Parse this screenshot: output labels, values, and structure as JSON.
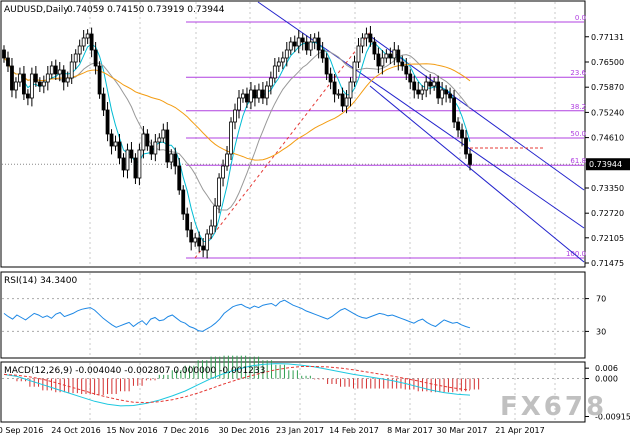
{
  "header": {
    "symbol": "AUDUSD,Daily",
    "ohlc": "0.74059 0.74150 0.73919 0.73944"
  },
  "watermark": "FX678",
  "chart_data": [
    {
      "type": "candlestick",
      "title": "AUDUSD,Daily",
      "ylim": [
        0.714,
        0.78
      ],
      "y_ticks": [
        "0.77131",
        "0.76500",
        "0.75870",
        "0.75240",
        "0.74610",
        "0.73944",
        "0.73350",
        "0.72720",
        "0.72105",
        "0.71475"
      ],
      "last_price": "0.73944",
      "x_ticks": [
        "30 Sep 2016",
        "24 Oct 2016",
        "15 Nov 2016",
        "7 Dec 2016",
        "30 Dec 2016",
        "23 Jan 2017",
        "14 Feb 2017",
        "8 Mar 2017",
        "30 Mar 2017",
        "21 Apr 2017"
      ],
      "closes": [
        0.766,
        0.764,
        0.758,
        0.76,
        0.762,
        0.757,
        0.756,
        0.762,
        0.76,
        0.759,
        0.76,
        0.762,
        0.764,
        0.762,
        0.763,
        0.76,
        0.761,
        0.765,
        0.767,
        0.769,
        0.771,
        0.772,
        0.768,
        0.764,
        0.757,
        0.753,
        0.747,
        0.744,
        0.745,
        0.741,
        0.738,
        0.743,
        0.741,
        0.736,
        0.743,
        0.747,
        0.744,
        0.742,
        0.745,
        0.746,
        0.748,
        0.74,
        0.742,
        0.739,
        0.733,
        0.727,
        0.723,
        0.72,
        0.721,
        0.719,
        0.718,
        0.722,
        0.724,
        0.729,
        0.736,
        0.739,
        0.742,
        0.75,
        0.753,
        0.756,
        0.757,
        0.755,
        0.758,
        0.756,
        0.758,
        0.756,
        0.759,
        0.761,
        0.764,
        0.765,
        0.766,
        0.768,
        0.77,
        0.769,
        0.771,
        0.77,
        0.768,
        0.77,
        0.771,
        0.768,
        0.766,
        0.762,
        0.76,
        0.757,
        0.757,
        0.754,
        0.756,
        0.76,
        0.765,
        0.769,
        0.771,
        0.772,
        0.77,
        0.767,
        0.764,
        0.766,
        0.767,
        0.766,
        0.768,
        0.765,
        0.764,
        0.762,
        0.76,
        0.758,
        0.757,
        0.758,
        0.76,
        0.759,
        0.76,
        0.756,
        0.758,
        0.757,
        0.756,
        0.75,
        0.748,
        0.746,
        0.742,
        0.7394
      ],
      "fib_levels": [
        {
          "label": "0.0",
          "value": 0.775
        },
        {
          "label": "23.6",
          "value": 0.7612
        },
        {
          "label": "38.2",
          "value": 0.7528
        },
        {
          "label": "50.0",
          "value": 0.746
        },
        {
          "label": "61.8",
          "value": 0.7392
        },
        {
          "label": "100.0",
          "value": 0.716
        }
      ],
      "moving_averages": [
        {
          "name": "fast",
          "color": "#00bcd4"
        },
        {
          "name": "medium",
          "color": "#999999"
        },
        {
          "name": "slow",
          "color": "#f39c12"
        }
      ]
    },
    {
      "type": "line",
      "title": "RSI(14) 34.3400",
      "ylim": [
        0,
        100
      ],
      "y_ticks": [
        "70",
        "30"
      ],
      "levels": [
        70,
        30
      ],
      "series": [
        {
          "name": "RSI(14)",
          "values": [
            52,
            48,
            45,
            50,
            47,
            44,
            48,
            52,
            50,
            47,
            49,
            46,
            51,
            53,
            48,
            50,
            52,
            55,
            57,
            58,
            59,
            56,
            51,
            46,
            42,
            38,
            35,
            37,
            39,
            41,
            36,
            40,
            43,
            38,
            45,
            47,
            43,
            44,
            48,
            50,
            46,
            42,
            40,
            36,
            34,
            31,
            30,
            33,
            36,
            40,
            45,
            52,
            56,
            60,
            62,
            63,
            60,
            58,
            61,
            59,
            62,
            63,
            64,
            61,
            66,
            68,
            65,
            62,
            60,
            58,
            55,
            53,
            51,
            49,
            47,
            45,
            48,
            52,
            56,
            58,
            55,
            52,
            49,
            47,
            46,
            48,
            50,
            52,
            51,
            49,
            50,
            48,
            46,
            44,
            42,
            40,
            43,
            45,
            41,
            38,
            36,
            40,
            44,
            42,
            40,
            41,
            38,
            36,
            34.34
          ],
          "color": "#1e88e5"
        }
      ]
    },
    {
      "type": "bar",
      "title": "MACD(12,26,9) -0.004040 -0.002807 0.000000 -0.001233",
      "ylim": [
        -0.01,
        0.0035
      ],
      "y_ticks": [
        "0.006",
        "0.000",
        "-0.009158"
      ],
      "series": [
        {
          "name": "MACD",
          "values": [
            0.001,
            0.0005,
            -0.0005,
            -0.0015,
            -0.0025,
            -0.0035,
            -0.0045,
            -0.0055,
            -0.0062,
            -0.0066,
            -0.0065,
            -0.006,
            -0.0052,
            -0.0042,
            -0.003,
            -0.0015,
            0.0,
            0.0012,
            0.0022,
            0.003,
            0.0034,
            0.0036,
            0.0035,
            0.0032,
            0.0028,
            0.0022,
            0.0016,
            0.001,
            0.0005,
            0.0,
            -0.0005,
            -0.0012,
            -0.002,
            -0.0028,
            -0.0034,
            -0.0038,
            -0.004
          ],
          "color": "#1ec8e0"
        },
        {
          "name": "Signal",
          "values": [
            0.001,
            0.0008,
            0.0004,
            -0.0002,
            -0.001,
            -0.0019,
            -0.0028,
            -0.0037,
            -0.0045,
            -0.0052,
            -0.0057,
            -0.0058,
            -0.0056,
            -0.0051,
            -0.0044,
            -0.0035,
            -0.0024,
            -0.0013,
            -0.0003,
            0.0006,
            0.0014,
            0.0021,
            0.0026,
            0.0029,
            0.0029,
            0.0028,
            0.0025,
            0.0021,
            0.0016,
            0.0011,
            0.0006,
            0.0,
            -0.0006,
            -0.0013,
            -0.0019,
            -0.0024,
            -0.0028
          ],
          "color": "#e53935"
        }
      ]
    }
  ]
}
